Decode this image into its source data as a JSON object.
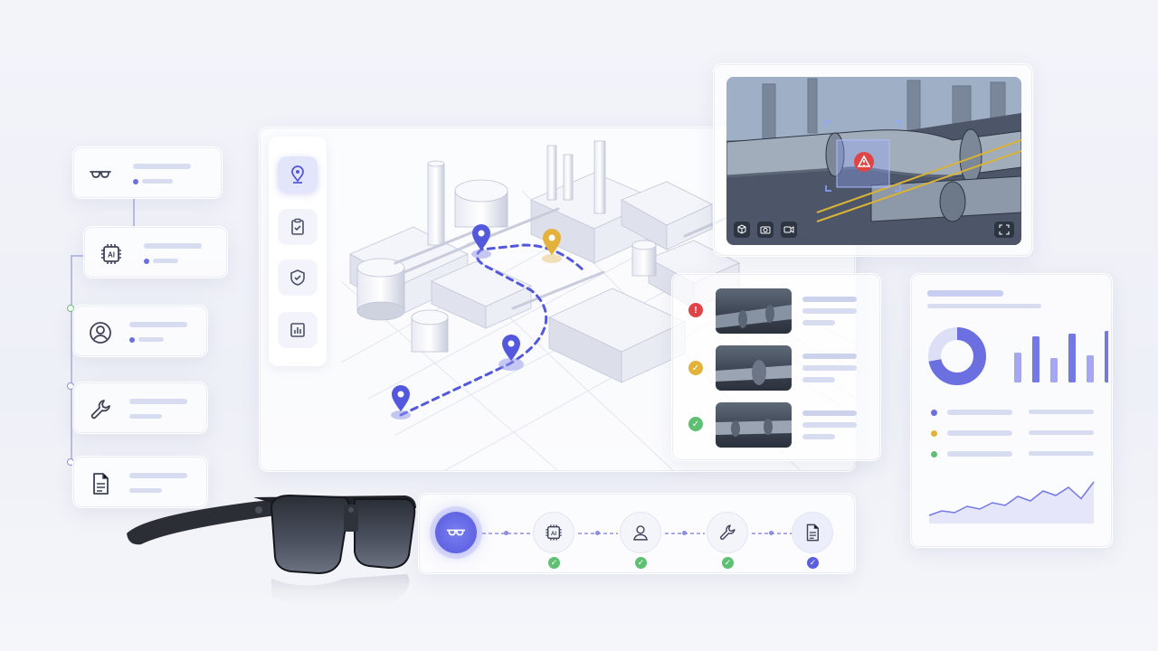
{
  "steps": [
    {
      "icon": "glasses-icon",
      "name": "step-glasses"
    },
    {
      "icon": "ai-chip-icon",
      "name": "step-ai",
      "ai_label": "AI"
    },
    {
      "icon": "user-icon",
      "name": "step-user"
    },
    {
      "icon": "wrench-icon",
      "name": "step-maintenance"
    },
    {
      "icon": "document-icon",
      "name": "step-report"
    }
  ],
  "map": {
    "tools": [
      "location-pin-icon",
      "clipboard-check-icon",
      "shield-check-icon",
      "bar-chart-icon"
    ],
    "active_tool": 0,
    "route_color": "#5458dd",
    "alert_pin_color": "#e4b23c"
  },
  "camera": {
    "alert_icon": "warning-triangle-icon",
    "controls": [
      "cube-icon",
      "camera-icon",
      "video-icon"
    ],
    "fullscreen_icon": "expand-icon"
  },
  "inspections": [
    {
      "status": "error",
      "color": "#e04545",
      "symbol": "!"
    },
    {
      "status": "pending",
      "color": "#e3b23a",
      "symbol": "✓"
    },
    {
      "status": "ok",
      "color": "#5fbf72",
      "symbol": "✓"
    }
  ],
  "dashboard": {
    "donut_fraction": 0.72,
    "bars": [
      0.55,
      0.85,
      0.45,
      0.9,
      0.5,
      0.95
    ],
    "legend_colors": [
      "#6b6fe0",
      "#e3b23a",
      "#5fbf72"
    ],
    "trend": [
      0.18,
      0.28,
      0.24,
      0.38,
      0.32,
      0.46,
      0.4,
      0.6,
      0.5,
      0.72,
      0.62,
      0.8,
      0.55,
      0.92
    ]
  },
  "flow": {
    "ai_label": "AI",
    "nodes": [
      "glasses-icon",
      "ai-chip-icon",
      "user-icon",
      "wrench-icon",
      "document-icon"
    ],
    "checks": [
      "",
      "✓",
      "✓",
      "✓",
      "✓"
    ],
    "accent": "#6367e4"
  }
}
